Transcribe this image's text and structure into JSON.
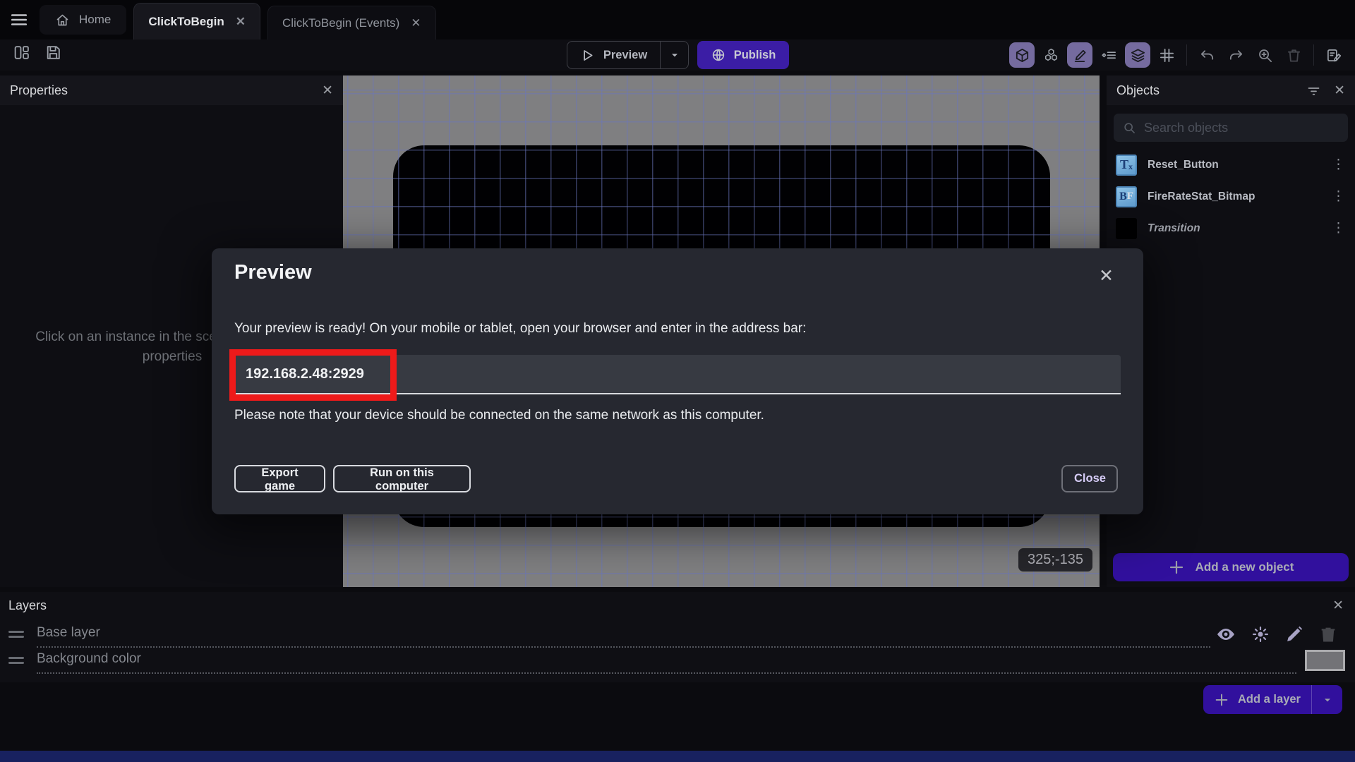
{
  "tabbar": {
    "tabs": [
      {
        "label": "Home"
      },
      {
        "label": "ClickToBegin"
      },
      {
        "label": "ClickToBegin (Events)"
      }
    ]
  },
  "toolbar": {
    "preview_label": "Preview",
    "publish_label": "Publish",
    "left_icons": [
      "panels-layout-icon",
      "save-icon"
    ],
    "right_icons": [
      "objects-panel-icon",
      "object-groups-icon",
      "edit-instance-icon",
      "instances-list-icon",
      "layers-panel-icon",
      "grid-icon",
      "undo-icon",
      "redo-icon",
      "zoom-in-icon",
      "delete-icon",
      "edit-scene-icon"
    ],
    "active_right_icons": [
      "objects-panel-icon",
      "edit-instance-icon",
      "layers-panel-icon"
    ]
  },
  "properties_panel": {
    "title": "Properties",
    "placeholder": "Click on an instance in the scene to display its properties"
  },
  "canvas": {
    "coordinates_badge": "325;-135"
  },
  "objects_panel": {
    "title": "Objects",
    "search_placeholder": "Search objects",
    "items": [
      {
        "name": "Reset_Button",
        "icon_label": "T",
        "icon_label2": "x",
        "icon_type": "text-object"
      },
      {
        "name": "FireRateStat_Bitmap",
        "icon_label": "B",
        "icon_label2": "F",
        "icon_type": "bitmap-font-object"
      },
      {
        "name": "Transition",
        "icon_label": "",
        "icon_label2": "",
        "icon_type": "black-square"
      }
    ],
    "add_button_label": "Add a new object"
  },
  "dialog": {
    "title": "Preview",
    "ready_text": "Your preview is ready! On your mobile or tablet, open your browser and enter in the address bar:",
    "address": "192.168.2.48:2929",
    "note": "Please note that your device should be connected on the same network as this computer.",
    "export_button": "Export game",
    "run_button": "Run on this computer",
    "close_button": "Close"
  },
  "layers_panel": {
    "title": "Layers",
    "layers": [
      {
        "name": "Base layer"
      },
      {
        "name": "Background color"
      }
    ],
    "add_button_label": "Add a layer"
  },
  "glyphs": {
    "close": "✕",
    "more_vertical": "⋮"
  },
  "colors": {
    "publish_button": "#3b1da5",
    "add_button": "#31109d",
    "toolbar_active_icon_bg": "#756b9f",
    "annotation_red": "#ee1a1a",
    "canvas_background": "#7f7f81",
    "grid_line": "#6a76bc",
    "modal_background": "#262830"
  }
}
